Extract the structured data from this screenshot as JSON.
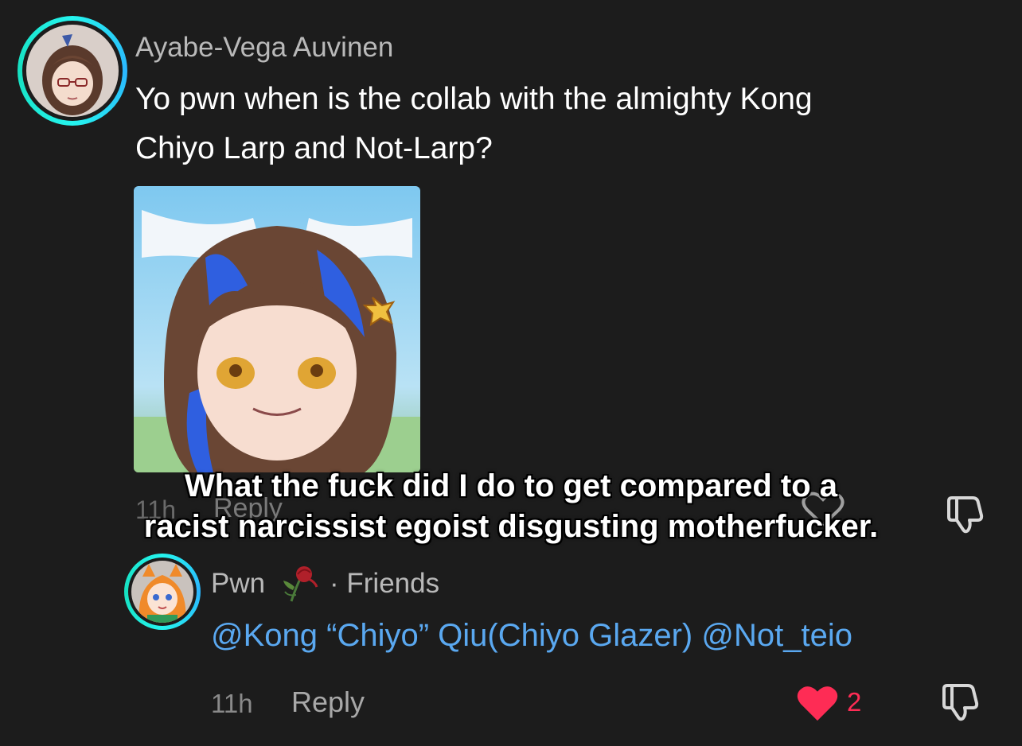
{
  "comment": {
    "username": "Ayabe-Vega Auvinen",
    "text_line1": "Yo pwn when is the collab with the almighty Kong",
    "text_line2": "Chiyo Larp and Not-Larp?",
    "time": "11h",
    "reply_label": "Reply"
  },
  "reply": {
    "username": "Pwn",
    "badge": "· Friends",
    "mention1": "@Kong “Chiyo” Qiu(Chiyo Glazer)",
    "mention2": "@Not_teio",
    "time": "11h",
    "reply_label": "Reply",
    "like_count": "2"
  },
  "caption": {
    "line1": "What the fuck did I do to get compared to a",
    "line2": "racist narcissist egoist disgusting motherfucker."
  },
  "colors": {
    "background": "#1c1c1c",
    "mention": "#5aa8f0",
    "like": "#fe2c55",
    "ring": "#25f4ee"
  },
  "icons": [
    "heart-icon",
    "dislike-icon",
    "rose-emoji-icon"
  ]
}
